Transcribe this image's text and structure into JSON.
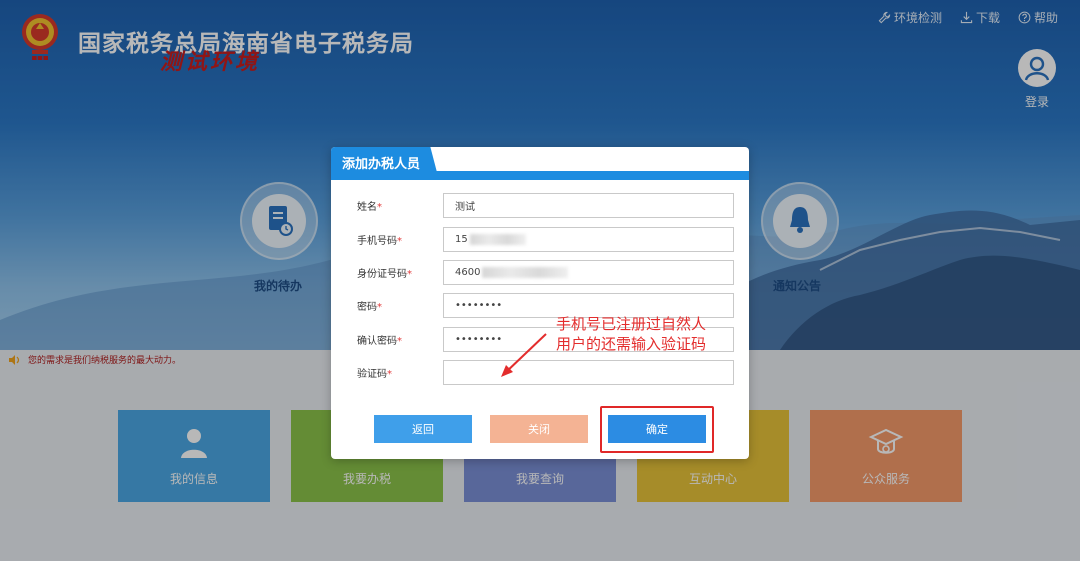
{
  "header": {
    "site_title": "国家税务总局海南省电子税务局",
    "environment_label": "测试环境",
    "top_links": [
      {
        "icon": "wrench-icon",
        "label": "环境检测"
      },
      {
        "icon": "download-icon",
        "label": "下载"
      },
      {
        "icon": "help-icon",
        "label": "帮助"
      }
    ],
    "login_label": "登录"
  },
  "hero": {
    "left_item": "我的待办",
    "right_item": "通知公告"
  },
  "notice_text": "您的需求是我们纳税服务的最大动力。",
  "tiles": [
    {
      "label": "我的信息",
      "color": "#4ba7e3"
    },
    {
      "label": "我要办税",
      "color": "#8bc34a"
    },
    {
      "label": "我要查询",
      "color": "#7b8fd6"
    },
    {
      "label": "互动中心",
      "color": "#e7c33a"
    },
    {
      "label": "公众服务",
      "color": "#f49a6a"
    }
  ],
  "dialog": {
    "title": "添加办税人员",
    "fields": [
      {
        "label": "姓名",
        "value": "测试"
      },
      {
        "label": "手机号码",
        "value": "15"
      },
      {
        "label": "身份证号码",
        "value": "4600"
      },
      {
        "label": "密码",
        "value": "••••••••"
      },
      {
        "label": "确认密码",
        "value": "••••••••"
      },
      {
        "label": "验证码",
        "value": ""
      }
    ],
    "required_mark": "*",
    "buttons": {
      "back": "返回",
      "close": "关闭",
      "confirm": "确定"
    }
  },
  "annotation": {
    "line1": "手机号已注册过自然人",
    "line2": "用户的还需输入验证码"
  },
  "colors": {
    "primary": "#1d8ce0",
    "annotation_red": "#e32d2d",
    "close_button": "#f4b394"
  }
}
